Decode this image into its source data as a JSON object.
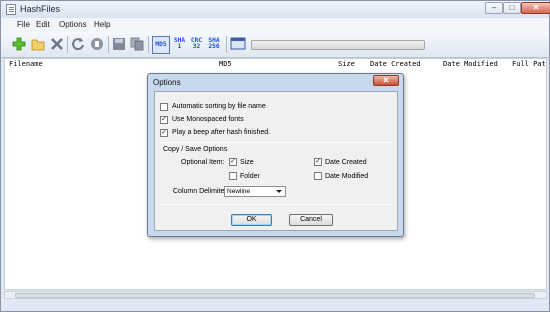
{
  "window": {
    "title": "HashFiles",
    "minimize": "–",
    "maximize": "□",
    "close": "✕"
  },
  "menu": [
    "File",
    "Edit",
    "Options",
    "Help"
  ],
  "toolbar": {
    "hash_buttons": [
      {
        "label": "MD5",
        "active": true
      },
      {
        "label": "SHA\n1",
        "active": false
      },
      {
        "label": "CRC\n32",
        "active": false
      },
      {
        "label": "SHA\n256",
        "active": false
      }
    ],
    "progress": 0
  },
  "list": {
    "columns": [
      "Filename",
      "MD5",
      "Size",
      "Date Created",
      "Date Modified",
      "Full Path"
    ]
  },
  "dialog": {
    "title": "Options",
    "close": "✕",
    "general": [
      {
        "label": "Automatic sorting by file name",
        "checked": false
      },
      {
        "label": "Use Monospaced fonts",
        "checked": true
      },
      {
        "label": "Play a beep after hash finished.",
        "checked": true
      }
    ],
    "copy_save_heading": "Copy / Save Options",
    "optional_item_label": "Optional Item:",
    "optional_items": [
      {
        "label": "Size",
        "checked": true
      },
      {
        "label": "Date Created",
        "checked": true
      },
      {
        "label": "Folder",
        "checked": false
      },
      {
        "label": "Date Modified",
        "checked": false
      }
    ],
    "delimiter_label": "Column Delimiter:",
    "delimiter_value": "Newline",
    "ok": "OK",
    "cancel": "Cancel"
  },
  "colors": {
    "accent": "#1c4fd8",
    "dialog_frame": "#c8d9ee",
    "close_red": "#cc4d34"
  }
}
